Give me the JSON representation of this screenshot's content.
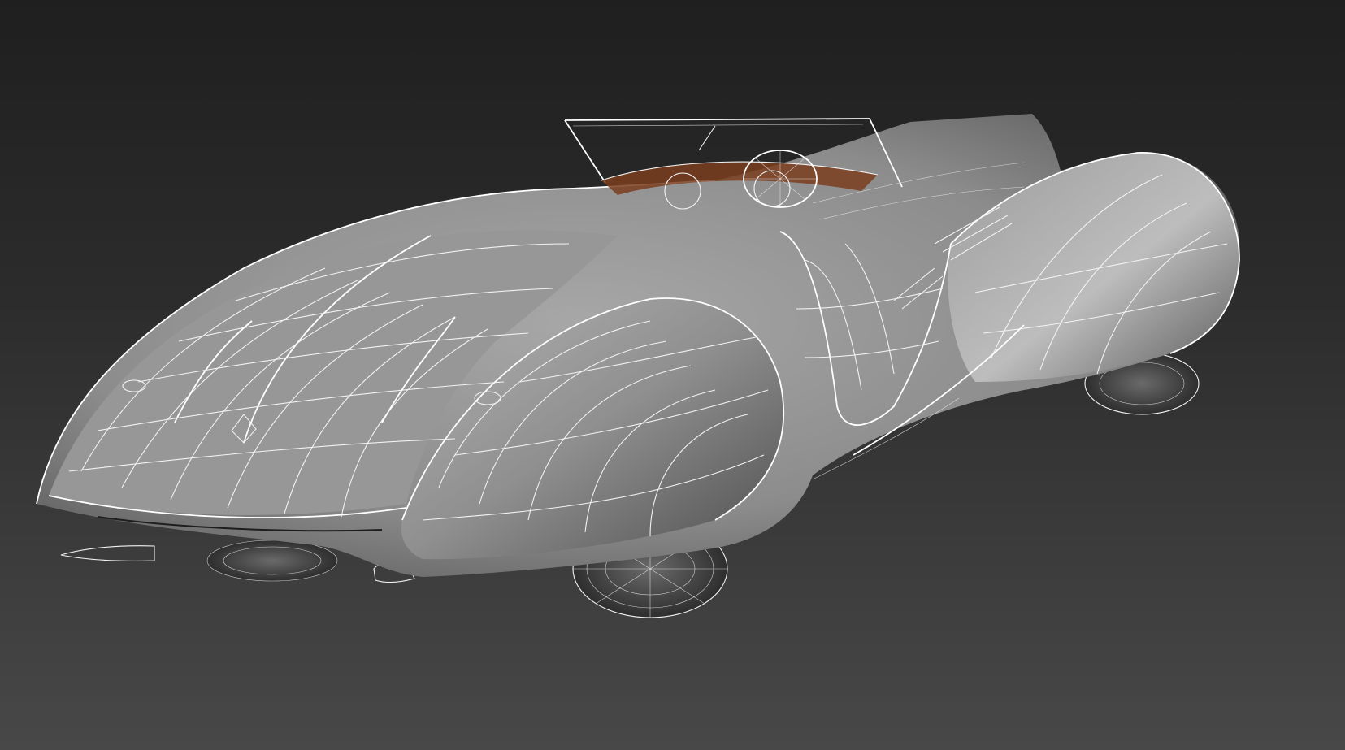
{
  "viewport": {
    "background_top": "#1f1f1f",
    "background_bottom": "#484848",
    "mesh_color": "#8c8c8c",
    "wire_color": "#f2f2f2",
    "interior_accent": "#7a3d1f"
  },
  "model": {
    "subject": "convertible-roadster-wireframe",
    "view": "rear-three-quarter",
    "shading": "smooth-shaded-with-wireframe-overlay"
  }
}
